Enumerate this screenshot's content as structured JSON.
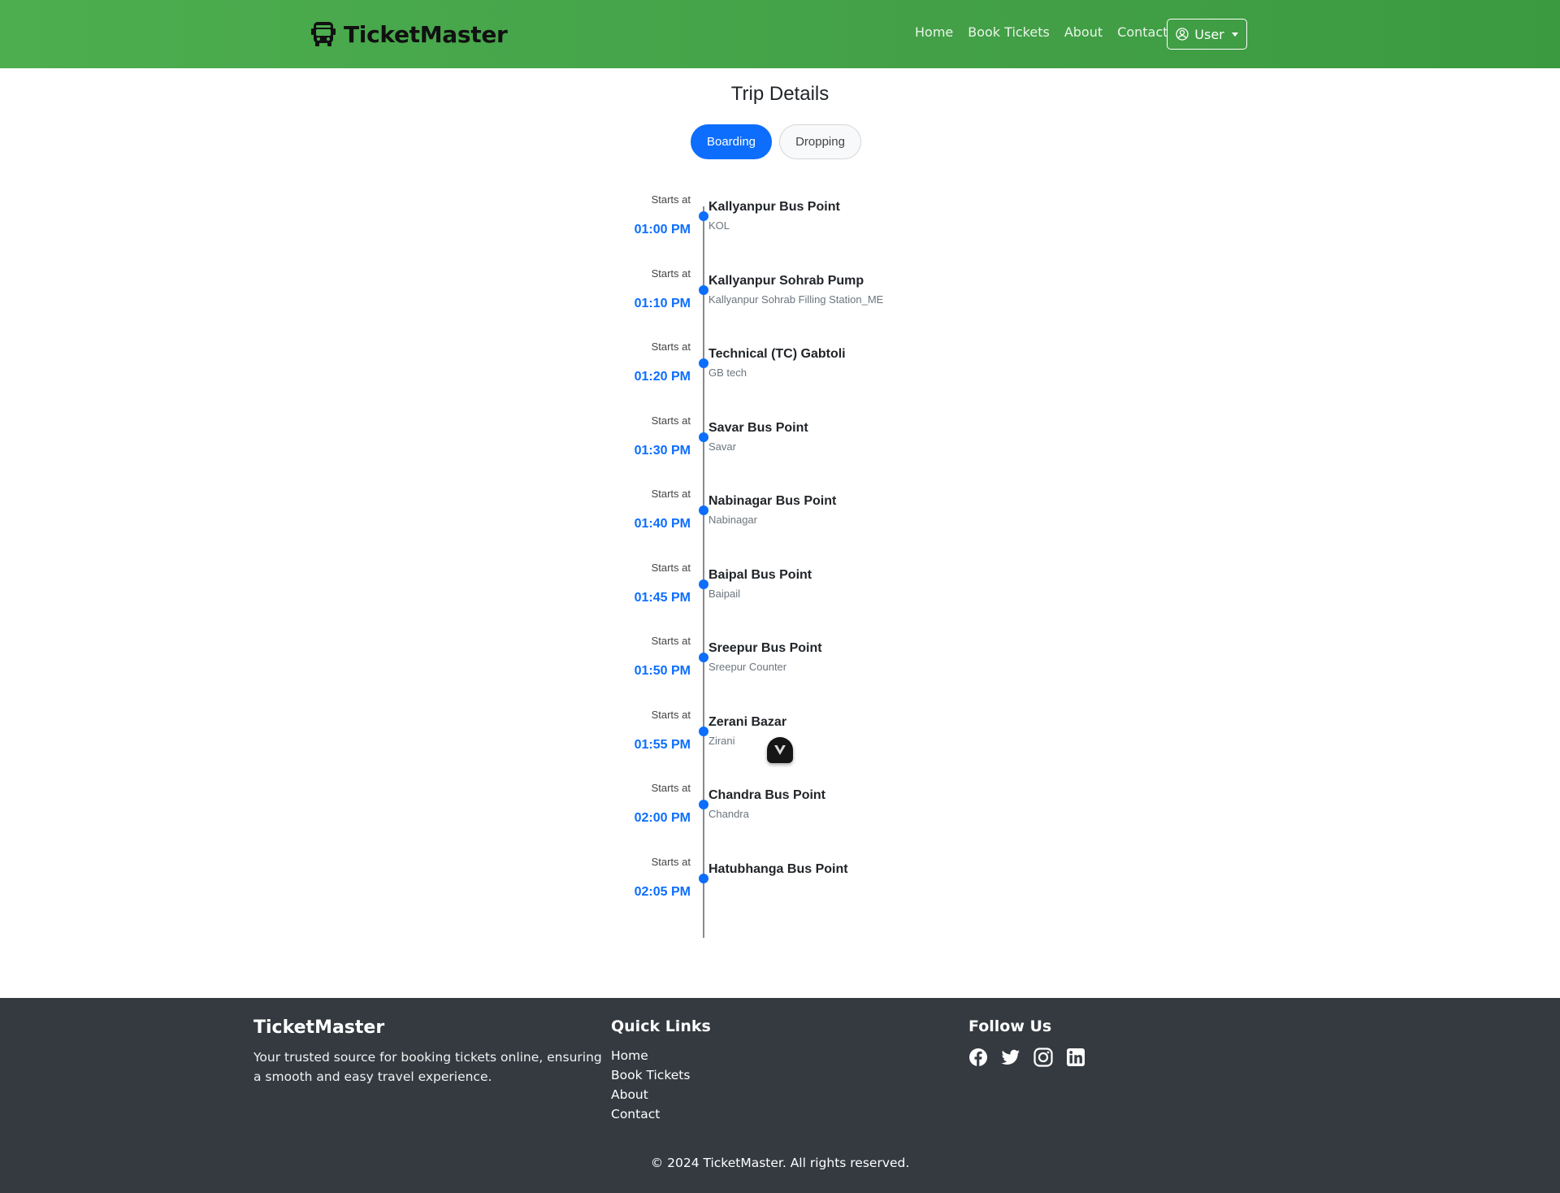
{
  "header": {
    "brand": "TicketMaster",
    "nav": [
      "Home",
      "Book Tickets",
      "About",
      "Contact"
    ],
    "user_label": "User"
  },
  "trip": {
    "title": "Trip Details",
    "tabs": {
      "boarding": "Boarding",
      "dropping": "Dropping",
      "active": "boarding"
    },
    "stops": [
      {
        "starts": "Starts at",
        "time": "01:00 PM",
        "name": "Kallyanpur Bus Point",
        "sub": "KOL"
      },
      {
        "starts": "Starts at",
        "time": "01:10 PM",
        "name": "Kallyanpur Sohrab Pump",
        "sub": "Kallyanpur Sohrab Filling Station_ME"
      },
      {
        "starts": "Starts at",
        "time": "01:20 PM",
        "name": "Technical (TC) Gabtoli",
        "sub": "GB tech"
      },
      {
        "starts": "Starts at",
        "time": "01:30 PM",
        "name": "Savar Bus Point",
        "sub": "Savar"
      },
      {
        "starts": "Starts at",
        "time": "01:40 PM",
        "name": "Nabinagar Bus Point",
        "sub": "Nabinagar"
      },
      {
        "starts": "Starts at",
        "time": "01:45 PM",
        "name": "Baipal Bus Point",
        "sub": "Baipail"
      },
      {
        "starts": "Starts at",
        "time": "01:50 PM",
        "name": "Sreepur Bus Point",
        "sub": "Sreepur Counter"
      },
      {
        "starts": "Starts at",
        "time": "01:55 PM",
        "name": "Zerani Bazar",
        "sub": "Zirani"
      },
      {
        "starts": "Starts at",
        "time": "02:00 PM",
        "name": "Chandra Bus Point",
        "sub": "Chandra"
      },
      {
        "starts": "Starts at",
        "time": "02:05 PM",
        "name": "Hatubhanga Bus Point",
        "sub": ""
      }
    ]
  },
  "footer": {
    "brand": "TicketMaster",
    "description": "Your trusted source for booking tickets online, ensuring a smooth and easy travel experience.",
    "quick_links_title": "Quick Links",
    "quick_links": [
      "Home",
      "Book Tickets",
      "About",
      "Contact"
    ],
    "follow_title": "Follow Us",
    "social_icons": [
      "facebook-icon",
      "twitter-icon",
      "instagram-icon",
      "linkedin-icon"
    ],
    "copyright": "© 2024 TicketMaster. All rights reserved."
  },
  "colors": {
    "header_green": "#43a047",
    "accent_blue": "#0d6efd",
    "footer_bg": "#343a40"
  }
}
